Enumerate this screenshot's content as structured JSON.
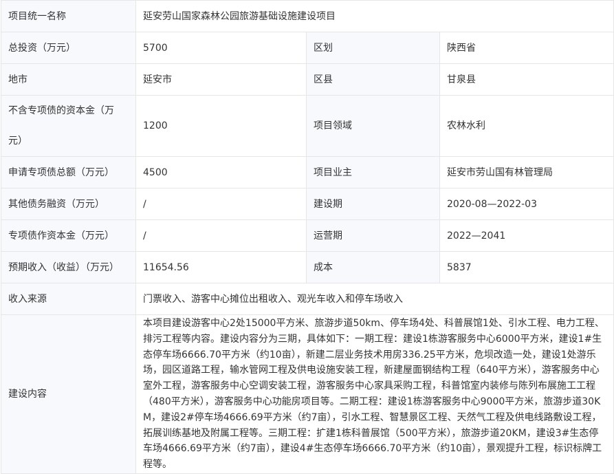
{
  "rows": {
    "project_name": {
      "label": "项目统一名称",
      "value": "延安劳山国家森林公园旅游基础设施建设项目"
    },
    "total_investment": {
      "label": "总投资（万元）",
      "value": "5700",
      "label2": "区划",
      "value2": "陕西省"
    },
    "city": {
      "label": "地市",
      "value": "延安市",
      "label2": "区县",
      "value2": "甘泉县"
    },
    "capital": {
      "label": "不含专项债的资本金（万元）",
      "value": "1200",
      "label2": "项目领域",
      "value2": "农林水利"
    },
    "special_bond": {
      "label": "申请专项债总额（万元）",
      "value": "4500",
      "label2": "项目业主",
      "value2": "延安市劳山国有林管理局"
    },
    "other_debt": {
      "label": "其他债务融资（万元）",
      "value": "/",
      "label2": "建设期",
      "value2": "2020-08—2022-03"
    },
    "bond_capital": {
      "label": "专项债作资本金（万元）",
      "value": "/",
      "label2": "运营期",
      "value2": "2022—2041"
    },
    "income": {
      "label": "预期收入（收益）（万元）",
      "value": "11654.56",
      "label2": "成本",
      "value2": "5837"
    },
    "income_source": {
      "label": "收入来源",
      "value": "门票收入、游客中心摊位出租收入、观光车收入和停车场收入"
    },
    "content": {
      "label": "建设内容",
      "value": "本项目建设游客中心2处15000平方米、旅游步道50km、停车场4处、科普展馆1处、引水工程、电力工程、排污工程等内容。建设内容分为三期，具体如下：一期工程：建设1栋游客服务中心6000平方米，建设1#生态停车场6666.70平方米（约10亩），新建二层业务技术用房336.25平方米，危坝改造一处，建设1处游乐场，园区道路工程，输水管网工程及供电设施安装工程，新建屋面钢结构工程（640平方米），游客服务中心室外工程，游客服务中心空调安装工程，游客服务中心家具采购工程，科普馆室内装修与陈列布展施工工程（480平方米），游客服务中心功能房项目等。二期工程：建设1栋游客服务中心9000平方米，旅游步道30KM，建设2#停车场4666.69平方米（约7亩），引水工程、智慧景区工程、天然气工程及供电线路敷设工程，拓展训练基地及附属工程等。三期工程：扩建1栋科普展馆（500平方米），旅游步道20KM，建设3#生态停车场4666.69平方米（约7亩），建设4#生态停车场6666.70平方米（约10亩），景观提升工程，标识标牌工程等。"
    }
  }
}
